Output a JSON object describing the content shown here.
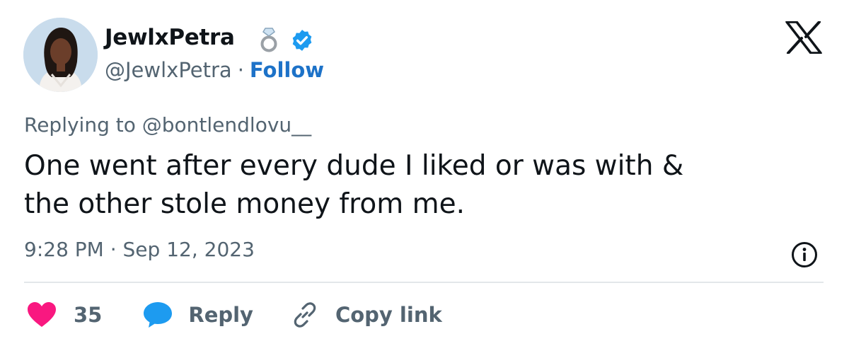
{
  "header": {
    "display_name": "JewlxPetra",
    "handle": "@JewlxPetra",
    "separator": "·",
    "follow_label": "Follow"
  },
  "tweet": {
    "replying_to": "Replying to @bontlendlovu__",
    "text_line1": "One went after every dude I liked or was with &",
    "text_line2": "the other stole money from me.",
    "timestamp": "9:28 PM · Sep 12, 2023"
  },
  "actions": {
    "like_count": "35",
    "reply_label": "Reply",
    "copy_link_label": "Copy link"
  },
  "icons": {
    "ring": "ring-emoji-icon",
    "verified": "verified-badge-icon",
    "logo": "x-logo-icon",
    "info": "info-icon",
    "like": "heart-icon",
    "reply": "speech-bubble-icon",
    "copy": "link-icon"
  },
  "colors": {
    "accent": "#1d9bf0",
    "follow": "#1d72c8",
    "like": "#f91880",
    "muted": "#536471",
    "text": "#0f1419"
  }
}
